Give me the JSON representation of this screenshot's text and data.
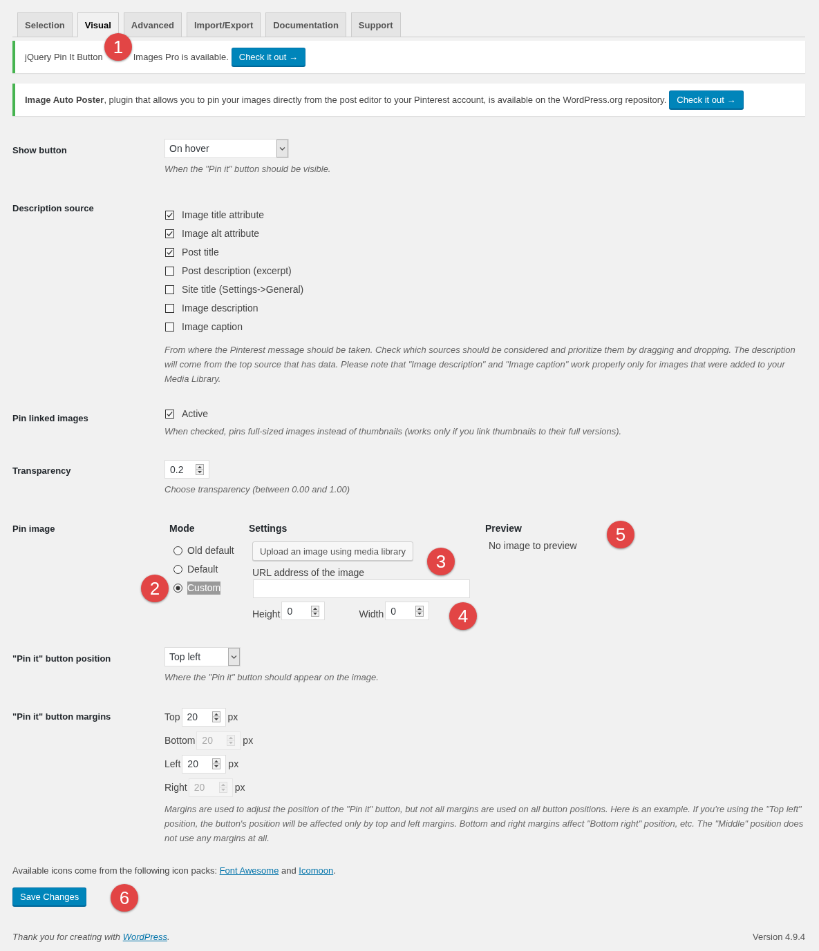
{
  "tabs": [
    {
      "label": "Selection",
      "selected": false
    },
    {
      "label": "Visual",
      "selected": true
    },
    {
      "label": "Advanced",
      "selected": false
    },
    {
      "label": "Import/Export",
      "selected": false
    },
    {
      "label": "Documentation",
      "selected": false
    },
    {
      "label": "Support",
      "selected": false
    }
  ],
  "notices": [
    {
      "segments": [
        "jQuery Pin It Button",
        "Images Pro is available."
      ],
      "button": "Check it out →"
    },
    {
      "segments": [
        "**Image Auto Poster**, plugin that allows you to pin your images directly from the post editor to your Pinterest account, is available on the WordPress.org repository."
      ],
      "button": "Check it out →"
    }
  ],
  "settings": [
    {
      "kind": "select",
      "label": "Show button",
      "value": "On hover",
      "description": "When the \"Pin it\" button should be visible."
    },
    {
      "kind": "checklist",
      "label": "Description source",
      "options": [
        {
          "label": "Image title attribute",
          "checked": true
        },
        {
          "label": "Image alt attribute",
          "checked": true
        },
        {
          "label": "Post title",
          "checked": true
        },
        {
          "label": "Post description (excerpt)",
          "checked": false
        },
        {
          "label": "Site title (Settings->General)",
          "checked": false
        },
        {
          "label": "Image description",
          "checked": false
        },
        {
          "label": "Image caption",
          "checked": false
        }
      ],
      "description": "From where the Pinterest message should be taken. Check which sources should be considered and prioritize them by dragging and dropping. The description will come from the top source that has data. Please note that \"Image description\" and \"Image caption\" work properly only for images that were added to your Media Library."
    },
    {
      "kind": "checkbox",
      "label": "Pin linked images",
      "options": [
        {
          "label": "Active",
          "checked": true
        }
      ],
      "description": "When checked, pins full-sized images instead of thumbnails (works only if you link thumbnails to their full versions)."
    },
    {
      "kind": "number",
      "label": "Transparency",
      "value": "0.2",
      "description": "Choose transparency (between 0.00 and 1.00)"
    },
    {
      "kind": "pin_image",
      "label": "Pin image",
      "mode": {
        "heading": "Mode",
        "options": [
          {
            "label": "Old default",
            "selected": false,
            "highlighted": false
          },
          {
            "label": "Default",
            "selected": false,
            "highlighted": false
          },
          {
            "label": "Custom",
            "selected": true,
            "highlighted": true
          }
        ]
      },
      "custom": {
        "heading": "Settings",
        "upload_button": "Upload an image using media library",
        "url_label": "URL address of the image",
        "height_label": "Height",
        "height_value": "0",
        "width_label": "Width",
        "width_value": "0"
      },
      "preview": {
        "heading": "Preview",
        "text": "No image to preview"
      }
    },
    {
      "kind": "select",
      "label": "\"Pin it\" button position",
      "value": "Top left",
      "description": "Where the \"Pin it\" button should appear on the image."
    },
    {
      "kind": "margins",
      "label": "\"Pin it\" button margins",
      "fields": [
        {
          "label": "Top",
          "value": "20",
          "unit": "px",
          "disabled": false
        },
        {
          "label": "Bottom",
          "value": "20",
          "unit": "px",
          "disabled": true
        },
        {
          "label": "Left",
          "value": "20",
          "unit": "px",
          "disabled": false
        },
        {
          "label": "Right",
          "value": "20",
          "unit": "px",
          "disabled": true
        }
      ],
      "description": "Margins are used to adjust the position of the \"Pin it\" button, but not all margins are used on all button positions. Here is an example. If you're using the \"Top left\" position, the button's position will be affected only by top and left margins. Bottom and right margins affect \"Bottom right\" position, etc. The \"Middle\" position does not use any margins at all."
    }
  ],
  "icon_note": [
    {
      "kind": "text",
      "text": "Available icons come from the following icon packs: "
    },
    {
      "kind": "link",
      "text": "Font Awesome"
    },
    {
      "kind": "text",
      "text": " and "
    },
    {
      "kind": "link",
      "text": "Icomoon"
    },
    {
      "kind": "text",
      "text": "."
    }
  ],
  "save_button": "Save Changes",
  "footer": {
    "credit": [
      {
        "kind": "text",
        "text": "Thank you for creating with "
      },
      {
        "kind": "link",
        "text": "WordPress"
      },
      {
        "kind": "text",
        "text": "."
      }
    ],
    "version": "Version 4.9.4"
  },
  "callouts": [
    "1",
    "2",
    "3",
    "4",
    "5",
    "6"
  ]
}
